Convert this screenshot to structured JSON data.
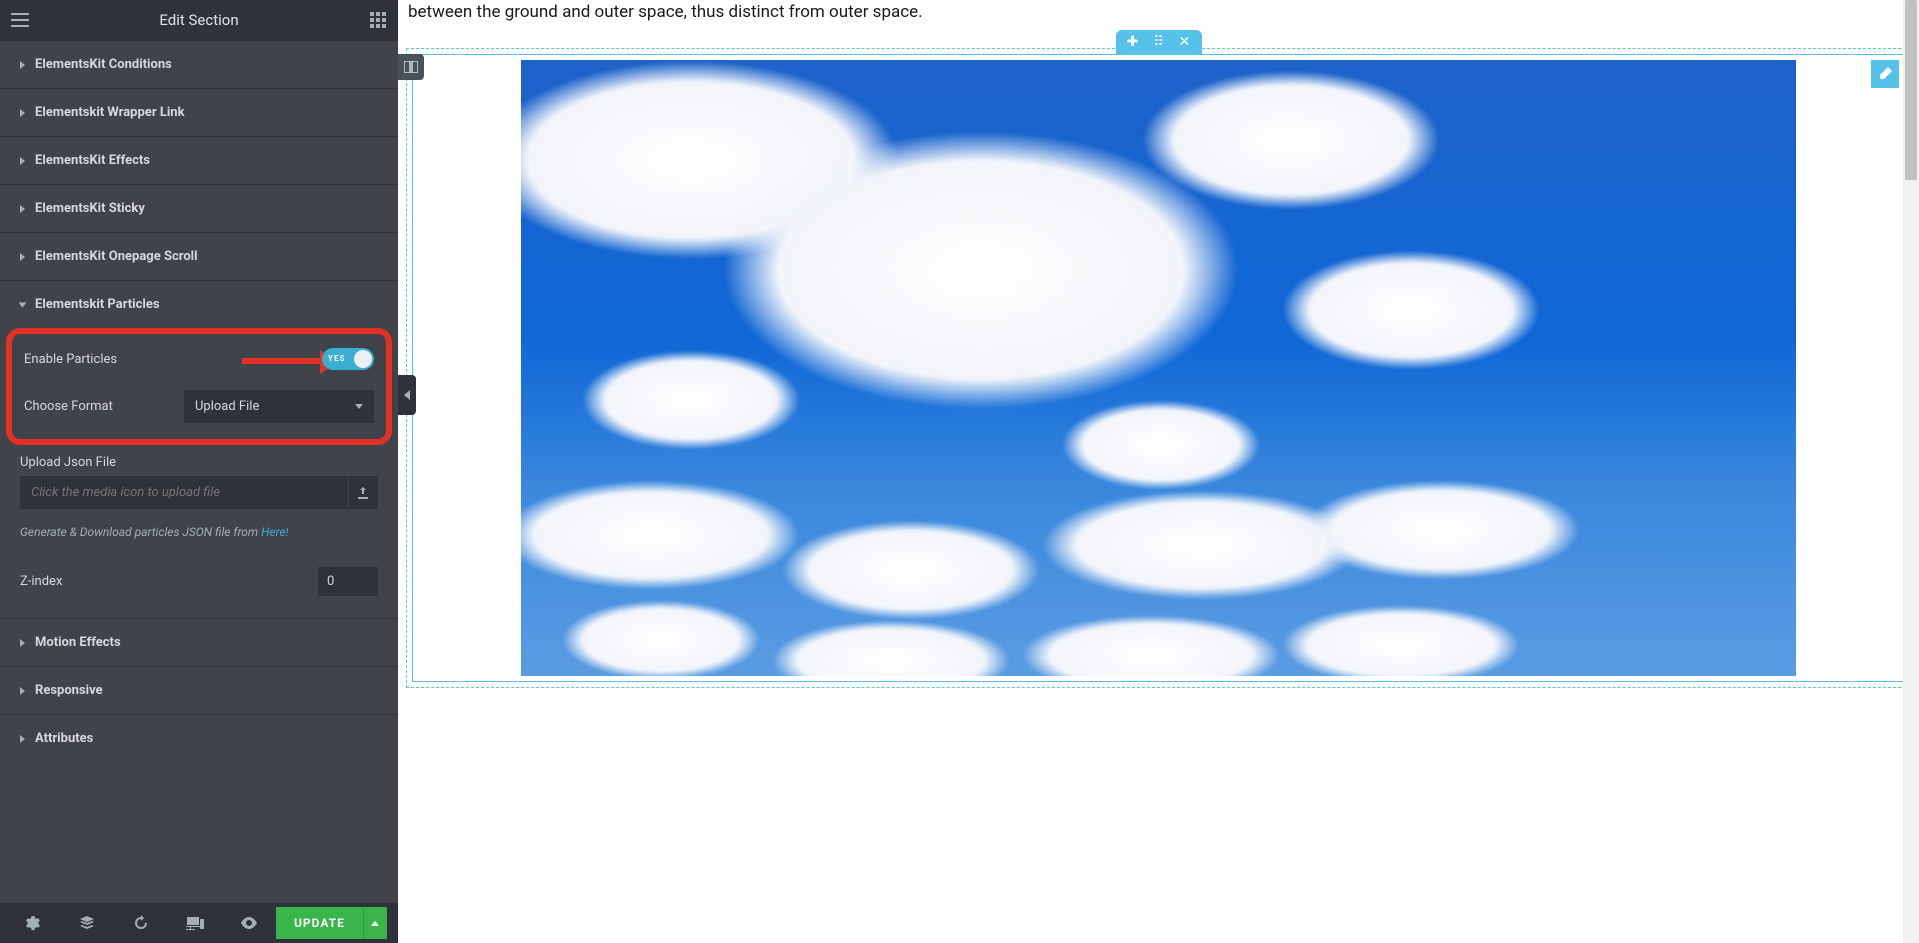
{
  "header": {
    "title": "Edit Section"
  },
  "panels": {
    "conditions": "ElementsKit Conditions",
    "wrapper_link": "Elementskit Wrapper Link",
    "effects": "ElementsKit Effects",
    "sticky": "ElementsKit Sticky",
    "onepage": "ElementsKit Onepage Scroll",
    "particles": "Elementskit Particles",
    "motion": "Motion Effects",
    "responsive": "Responsive",
    "attributes": "Attributes"
  },
  "particles_panel": {
    "enable_label": "Enable Particles",
    "toggle_state": "YES",
    "format_label": "Choose Format",
    "format_value": "Upload File",
    "upload_label": "Upload Json File",
    "upload_placeholder": "Click the media icon to upload file",
    "hint_prefix": "Generate & Download particles JSON file from ",
    "hint_link": "Here!",
    "zindex_label": "Z-index",
    "zindex_value": "0"
  },
  "footer": {
    "update": "UPDATE"
  },
  "canvas": {
    "intro_text": "between the ground and outer space, thus distinct from outer space."
  }
}
